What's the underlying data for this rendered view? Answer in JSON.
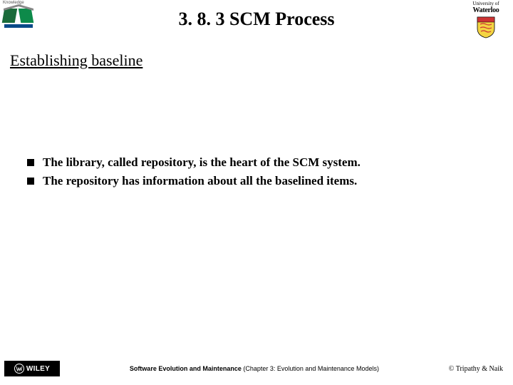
{
  "header": {
    "logo_left_label": "Knowledge",
    "logo_right_line1": "University of",
    "logo_right_line2": "Waterloo"
  },
  "title": "3. 8. 3 SCM Process",
  "subtitle": "Establishing baseline",
  "bullets": [
    "The library, called repository, is the heart of the SCM system.",
    "The repository has information about all the baselined items."
  ],
  "footer": {
    "publisher": "WILEY",
    "center_bold": "Software Evolution and Maintenance",
    "center_rest": " (Chapter 3: Evolution and Maintenance Models)",
    "copyright": "© Tripathy & Naik"
  }
}
